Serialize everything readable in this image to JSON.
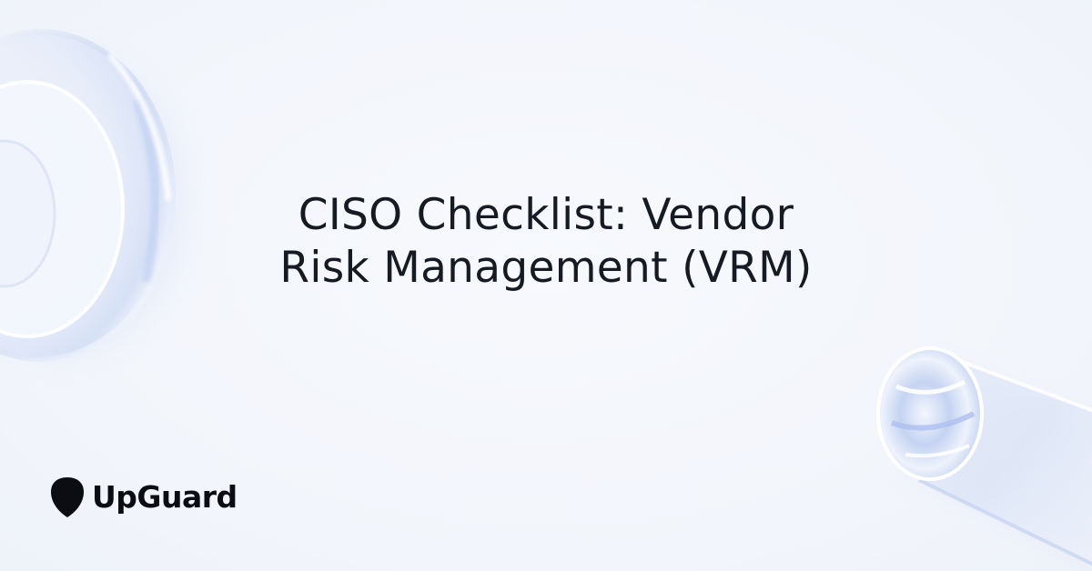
{
  "headline": {
    "line1": "CISO Checklist: Vendor",
    "line2": "Risk Management (VRM)"
  },
  "brand": {
    "name": "UpGuard",
    "icon": "upguard-shield-icon"
  },
  "colors": {
    "background": "#f3f6fc",
    "text": "#161a22",
    "brand": "#0b0d12",
    "glass_tint": "#c9d6f2"
  }
}
